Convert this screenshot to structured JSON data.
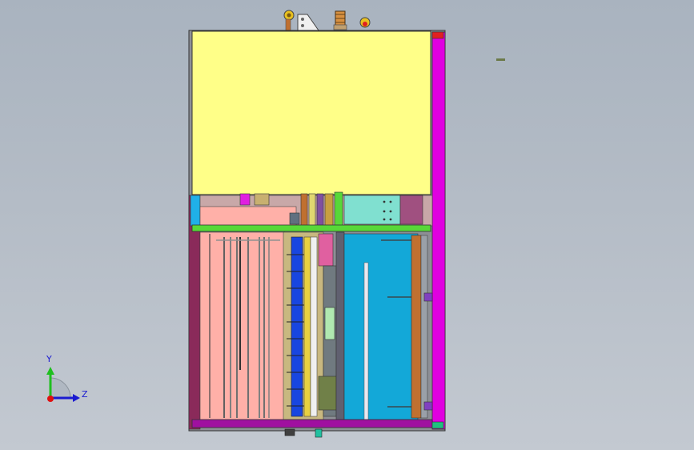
{
  "triad": {
    "y_label": "Y",
    "z_label": "Z"
  },
  "colors": {
    "background_top": "#a9b3bf",
    "frame_magenta": "#e000e0",
    "top_panel_yellow": "#ffff88",
    "front_panel_pink": "#ffb0a8",
    "tank_blue": "#13a8d8",
    "rail_green": "#58d838",
    "axis_y": "#1fbf1f",
    "axis_z": "#1b1bd0",
    "axis_origin": "#e01010"
  }
}
